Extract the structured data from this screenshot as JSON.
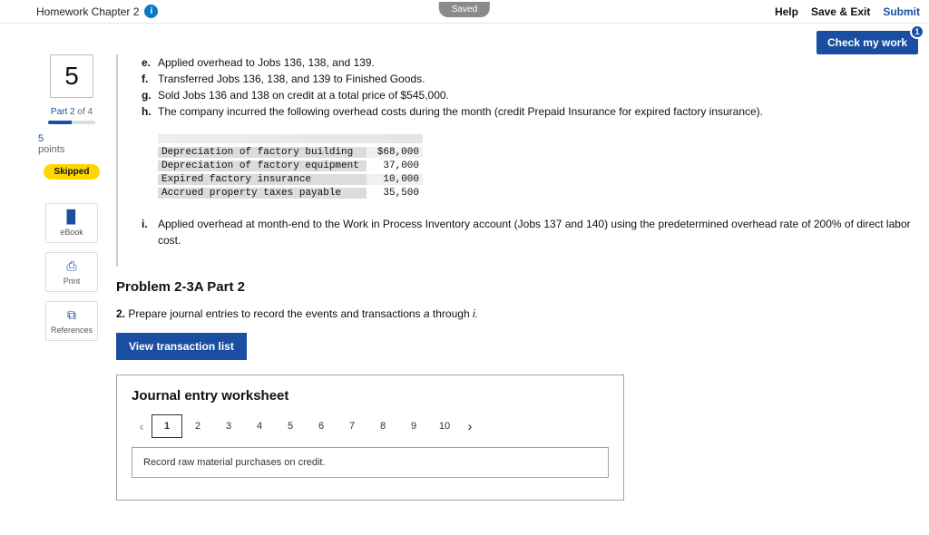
{
  "topbar": {
    "title": "Homework Chapter 2",
    "saved": "Saved",
    "help": "Help",
    "save_exit": "Save & Exit",
    "submit": "Submit"
  },
  "check_my_work": {
    "label": "Check my work",
    "badge": "1"
  },
  "sidebar": {
    "question_number": "5",
    "part_label": "Part 2",
    "part_of": " of 4",
    "points_value": "5",
    "points_label": "points",
    "skipped": "Skipped",
    "tools": {
      "ebook": "eBook",
      "print": "Print",
      "references": "References"
    }
  },
  "problem": {
    "items": {
      "e": {
        "letter": "e.",
        "text": "Applied overhead to Jobs 136, 138, and 139."
      },
      "f": {
        "letter": "f.",
        "text": "Transferred Jobs 136, 138, and 139 to Finished Goods."
      },
      "g": {
        "letter": "g.",
        "text": "Sold Jobs 136 and 138 on credit at a total price of $545,000."
      },
      "h": {
        "letter": "h.",
        "text": "The company incurred the following overhead costs during the month (credit Prepaid Insurance for expired factory insurance)."
      },
      "i": {
        "letter": "i.",
        "text": "Applied overhead at month-end to the Work in Process Inventory account (Jobs 137 and 140) using the predetermined overhead rate of 200% of direct labor cost."
      }
    },
    "costs": [
      {
        "label": "Depreciation of factory building",
        "value": "$68,000"
      },
      {
        "label": "Depreciation of factory equipment",
        "value": "37,000"
      },
      {
        "label": "Expired factory insurance",
        "value": "10,000"
      },
      {
        "label": "Accrued property taxes payable",
        "value": "35,500"
      }
    ]
  },
  "section": {
    "title": "Problem 2-3A Part 2",
    "instruction_num": "2.",
    "instruction_text": "Prepare journal entries to record the events and transactions ",
    "instruction_ital": "a",
    "instruction_text2": " through ",
    "instruction_ital2": "i.",
    "view_transactions": "View transaction list"
  },
  "journal": {
    "title": "Journal entry worksheet",
    "tabs": [
      "1",
      "2",
      "3",
      "4",
      "5",
      "6",
      "7",
      "8",
      "9",
      "10"
    ],
    "active_tab": "1",
    "entry_instruction": "Record raw material purchases on credit."
  }
}
